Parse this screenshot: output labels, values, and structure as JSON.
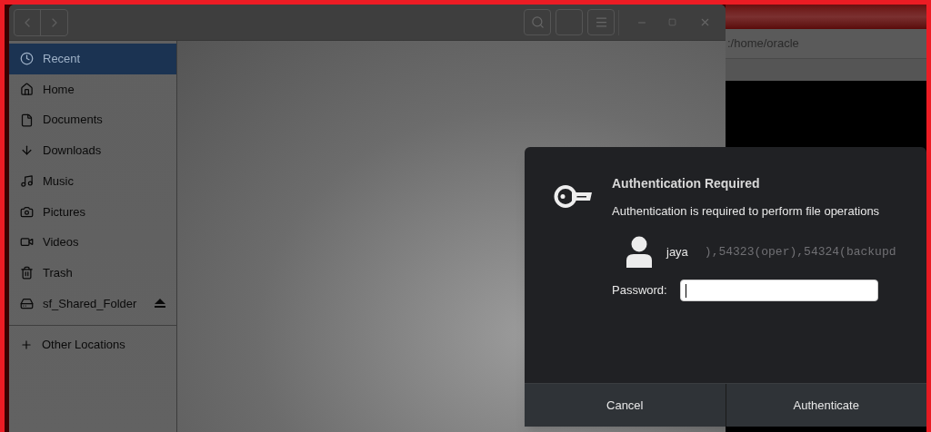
{
  "file_manager": {
    "sidebar": {
      "items": [
        {
          "label": "Recent",
          "selected": true,
          "eject": false
        },
        {
          "label": "Home",
          "selected": false,
          "eject": false
        },
        {
          "label": "Documents",
          "selected": false,
          "eject": false
        },
        {
          "label": "Downloads",
          "selected": false,
          "eject": false
        },
        {
          "label": "Music",
          "selected": false,
          "eject": false
        },
        {
          "label": "Pictures",
          "selected": false,
          "eject": false
        },
        {
          "label": "Videos",
          "selected": false,
          "eject": false
        },
        {
          "label": "Trash",
          "selected": false,
          "eject": false
        },
        {
          "label": "sf_Shared_Folder",
          "selected": false,
          "eject": true
        }
      ],
      "other_locations": {
        "label": "Other Locations"
      }
    }
  },
  "terminal": {
    "path": ":/home/oracle",
    "output_line": "),54323(oper),54324(backupd"
  },
  "dialog": {
    "title": "Authentication Required",
    "message": "Authentication is required to perform file operations",
    "user": "jaya",
    "password_label": "Password:",
    "buttons": [
      {
        "label": "Cancel"
      },
      {
        "label": "Authenticate"
      }
    ]
  }
}
